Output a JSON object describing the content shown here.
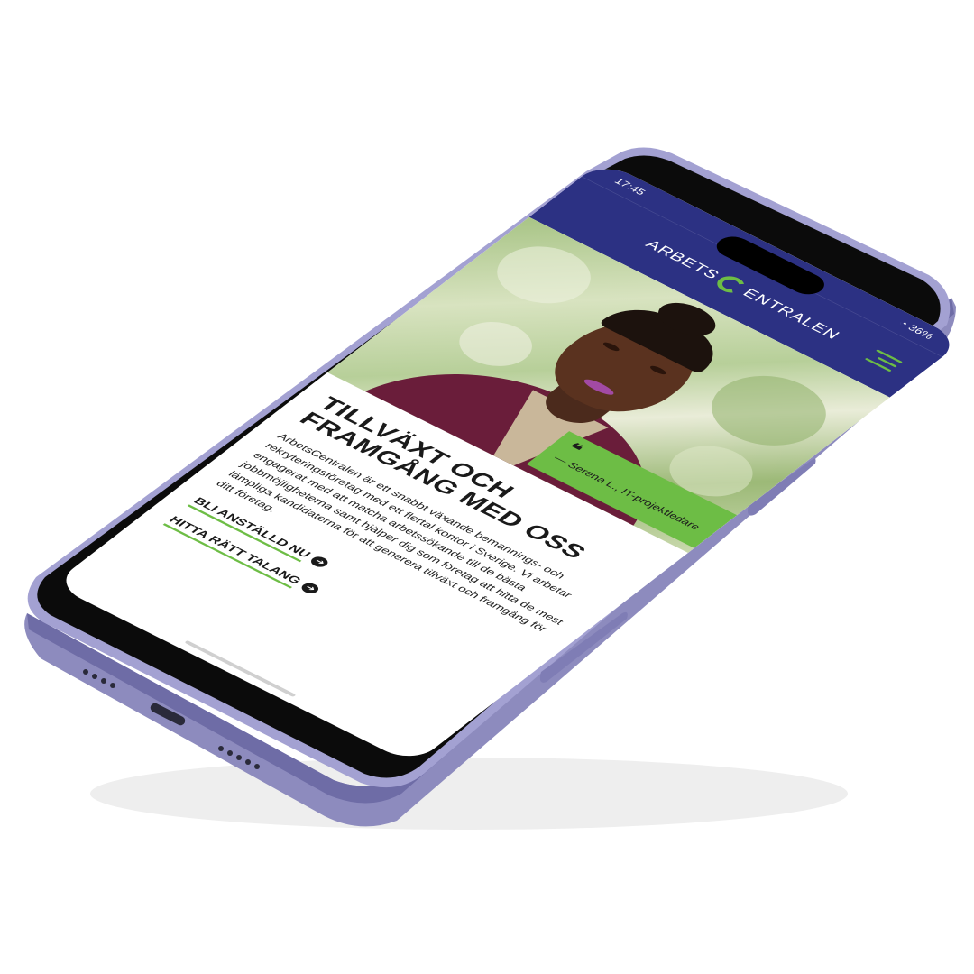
{
  "status_bar": {
    "time": "17:45",
    "battery": "36%"
  },
  "header": {
    "logo_left": "ARBETS",
    "logo_right": "ENTRALEN"
  },
  "hero": {
    "quote_mark": "❝",
    "quote_author": "— Serena L., IT-projektledare"
  },
  "main": {
    "headline": "TILLVÄXT OCH FRAMGÅNG MED OSS",
    "intro": "ArbetsCentralen är ett snabbt växande bemannings- och rekryteringsföretag med ett flertal kontor i Sverige. Vi arbetar engagerat med att matcha arbetssökande till de bästa jobbmöjligheterna samt hjälper dig som företag att hitta de mest lämpliga kandidaterna för att generera tillväxt och framgång för ditt företag.",
    "cta_primary": "BLI ANSTÄLLD NU",
    "cta_secondary": "HITTA RÄTT TALANG"
  },
  "colors": {
    "brand_navy": "#2c3183",
    "brand_green": "#6dbd45",
    "phone_frame": "#8e8cc2"
  }
}
